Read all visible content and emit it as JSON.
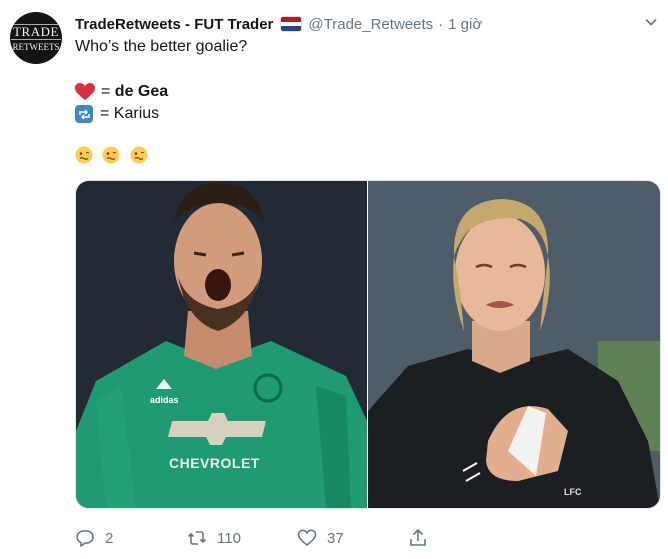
{
  "tweet": {
    "author_name": "TradeRetweets - FUT Trader",
    "handle": "@Trade_Retweets",
    "time": "1 giờ",
    "separator": "·",
    "line1": "Who’s the better goalie?",
    "opt1_sep": "=",
    "opt1_name": "de Gea",
    "opt2_sep": "=",
    "opt2_name": "Karius",
    "avatar_text_top": "TRADE",
    "avatar_text_bottom": "RETWEETS"
  },
  "media": {
    "left_shirt_text": "CHEVROLET",
    "left_brand": "adidas",
    "right_badge": "LFC"
  },
  "actions": {
    "reply_count": "2",
    "retweet_count": "110",
    "like_count": "37"
  },
  "colors": {
    "text": "#14171a",
    "secondary": "#657786",
    "heart": "#dd2e44",
    "retweet_emoji": "#3b88c3"
  },
  "icons": [
    "chevron-down-icon",
    "red-heart-emoji",
    "retweet-emoji",
    "woozy-face-emoji",
    "reply-icon",
    "retweet-icon",
    "like-icon",
    "share-icon"
  ]
}
